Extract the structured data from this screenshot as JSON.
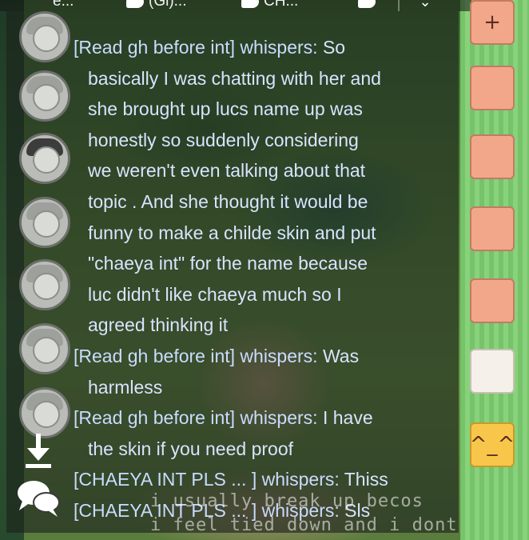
{
  "top_tabs": [
    {
      "label": "e...",
      "icon": "chat-bubble-icon"
    },
    {
      "label": "(Gl)...",
      "icon": "chat-bubble-icon"
    },
    {
      "label": "CH...",
      "icon": "chat-bubble-icon"
    },
    {
      "label": "",
      "icon": "chat-bubble-icon"
    }
  ],
  "messages": [
    {
      "sender": "[Read gh before int] whispers:",
      "lines": [
        "So",
        "basically I was chatting with her and",
        "she brought up lucs name up was",
        "honestly so suddenly considering",
        "we weren't even talking about that",
        "topic . And she thought it would be",
        "funny to make a childe skin and put",
        "\"chaeya int\" for the name because",
        "luc didn't like chaeya much so I",
        "agreed thinking it"
      ]
    },
    {
      "sender": "[Read gh before int] whispers:",
      "lines": [
        "Was",
        "harmless"
      ]
    },
    {
      "sender": "[Read gh before int] whispers:",
      "lines": [
        "I have",
        "the skin if you need proof"
      ]
    },
    {
      "sender": "[CHAEYA INT PLS ... ] whispers:",
      "lines": [
        "Thiss"
      ]
    },
    {
      "sender": "[CHAEYA INT PLS ... ] whispers:",
      "lines": [
        "Sls"
      ]
    }
  ],
  "overlay": {
    "line1": "i usually break up becos",
    "line2": "i feel tied down and i dont"
  },
  "emotes": [
    "+",
    "",
    "",
    "",
    "",
    "",
    "^_^"
  ]
}
